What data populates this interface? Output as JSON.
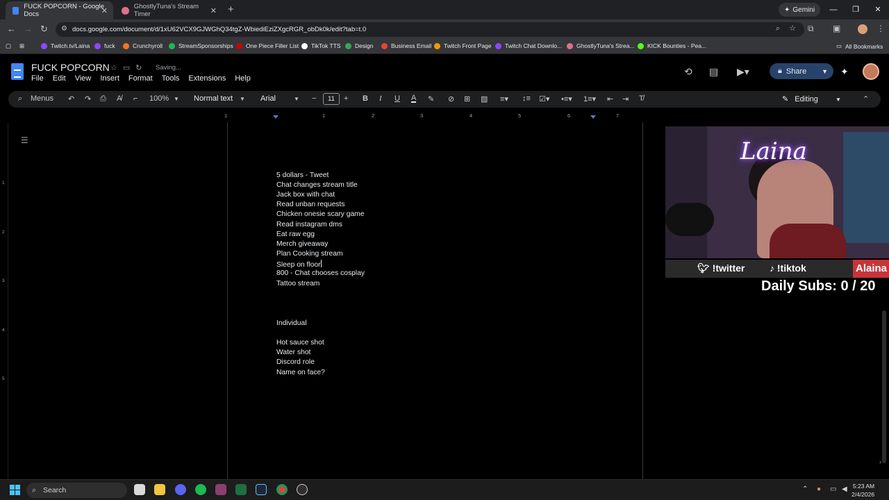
{
  "browser": {
    "tabs": [
      {
        "title": "FUCK POPCORN - Google Docs",
        "active": true,
        "favicon_color": "#4285f4"
      },
      {
        "title": "GhostlyTuna's Stream Timer",
        "active": false,
        "favicon_color": "#e0708a"
      }
    ],
    "gemini_label": "Gemini",
    "url": "docs.google.com/document/d/1xU62VCX9GJWGhQ34tgZ-WbiediEziZXgcRGR_obDk0k/edit?tab=t.0",
    "bookmarks": [
      {
        "label": "Twitch.tv/Laina",
        "color": "#9146ff"
      },
      {
        "label": "fuck",
        "color": "#9146ff"
      },
      {
        "label": "Crunchyroll",
        "color": "#f47521"
      },
      {
        "label": "StreamSponsorships",
        "color": "#1db954"
      },
      {
        "label": "One Piece Filler List",
        "color": "#cc0000"
      },
      {
        "label": "TikTok TTS",
        "color": "#ffffff"
      },
      {
        "label": "Design",
        "color": "#34a853"
      },
      {
        "label": "Business Email",
        "color": "#ea4335"
      },
      {
        "label": "Twitch Front Page",
        "color": "#f29900"
      },
      {
        "label": "Twitch Chat Downlo...",
        "color": "#9146ff"
      },
      {
        "label": "GhostlyTuna's Strea...",
        "color": "#e0708a"
      },
      {
        "label": "KICK Bounties - Pea...",
        "color": "#53fc18"
      }
    ],
    "all_bookmarks": "All Bookmarks"
  },
  "docs": {
    "title": "FUCK POPCORN",
    "saving": "Saving...",
    "menu": [
      "File",
      "Edit",
      "View",
      "Insert",
      "Format",
      "Tools",
      "Extensions",
      "Help"
    ],
    "share_label": "Share",
    "toolbar": {
      "menus_label": "Menus",
      "zoom": "100%",
      "style": "Normal text",
      "font": "Arial",
      "font_size": "11",
      "mode": "Editing"
    },
    "ruler_numbers": [
      "1",
      "1",
      "2",
      "3",
      "4",
      "5",
      "6",
      "7"
    ],
    "vruler_numbers": [
      "1",
      "2",
      "3",
      "4",
      "5"
    ],
    "lines": [
      "5 dollars - Tweet",
      "Chat changes stream title",
      "Jack box with chat",
      "Read unban requests",
      "Chicken onesie scary game",
      "Read instagram dms",
      "Eat raw egg",
      "Merch giveaway",
      "Plan Cooking stream",
      "Sleep on floor",
      "800 - Chat chooses cosplay",
      "Tattoo stream",
      "",
      "",
      "",
      "Individual",
      "",
      "Hot sauce shot",
      "Water shot",
      "Discord role",
      "Name on face?"
    ]
  },
  "overlay": {
    "neon_sign": "Laina",
    "twitter": "!twitter",
    "tiktok": "!tiktok",
    "name": "Alaina",
    "daily_subs": "Daily Subs: 0 / 20"
  },
  "taskbar": {
    "search_label": "Search",
    "time": "5:23 AM",
    "date": "2/4/2026"
  }
}
